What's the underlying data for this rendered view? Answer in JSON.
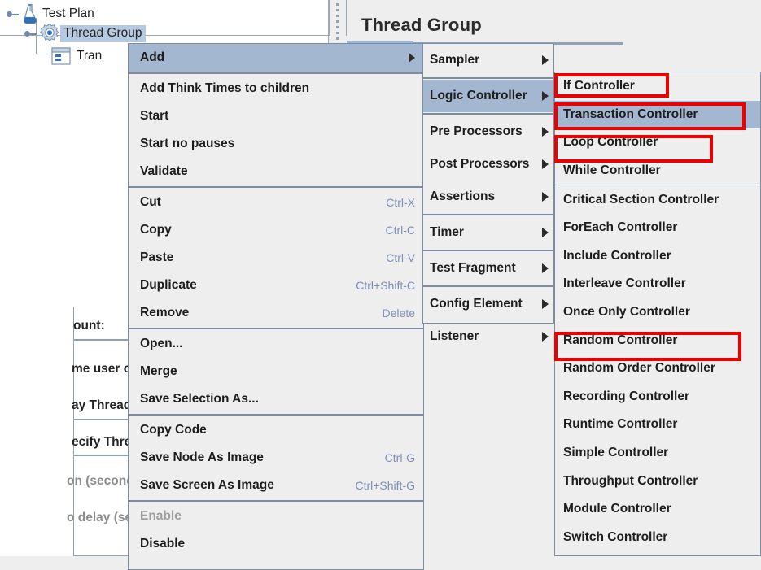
{
  "app": {
    "tree": {
      "nodes": [
        {
          "label": "Test Plan",
          "icon": "flask-icon",
          "selected": false
        },
        {
          "label": "Thread Group",
          "icon": "gear-icon",
          "selected": true
        },
        {
          "label": "Tran",
          "icon": "transaction-controller-icon",
          "selected": false
        }
      ]
    },
    "right_panel": {
      "title": "Thread Group",
      "background_text": {
        "count_label": "ount:",
        "hash_marks": "|||||||",
        "line1": "me user on each ite",
        "line2": "ay Thread creation",
        "line3": "ecify Thread lifetim",
        "line4": "on (seconds):",
        "line5": "o delay (seconds):"
      }
    }
  },
  "context_menu": {
    "items": [
      {
        "label": "Add",
        "accel": "",
        "submenu": true,
        "highlighted": true,
        "separator_after": true
      },
      {
        "label": "Add Think Times to children",
        "accel": "",
        "submenu": false
      },
      {
        "label": "Start",
        "accel": "",
        "submenu": false
      },
      {
        "label": "Start no pauses",
        "accel": "",
        "submenu": false
      },
      {
        "label": "Validate",
        "accel": "",
        "submenu": false,
        "separator_after": true
      },
      {
        "label": "Cut",
        "accel": "Ctrl-X",
        "submenu": false
      },
      {
        "label": "Copy",
        "accel": "Ctrl-C",
        "submenu": false
      },
      {
        "label": "Paste",
        "accel": "Ctrl-V",
        "submenu": false
      },
      {
        "label": "Duplicate",
        "accel": "Ctrl+Shift-C",
        "submenu": false
      },
      {
        "label": "Remove",
        "accel": "Delete",
        "submenu": false,
        "separator_after": true
      },
      {
        "label": "Open...",
        "accel": "",
        "submenu": false
      },
      {
        "label": "Merge",
        "accel": "",
        "submenu": false
      },
      {
        "label": "Save Selection As...",
        "accel": "",
        "submenu": false,
        "separator_after": true
      },
      {
        "label": "Copy Code",
        "accel": "",
        "submenu": false
      },
      {
        "label": "Save Node As Image",
        "accel": "Ctrl-G",
        "submenu": false
      },
      {
        "label": "Save Screen As Image",
        "accel": "Ctrl+Shift-G",
        "submenu": false,
        "separator_after": true
      },
      {
        "label": "Enable",
        "accel": "",
        "submenu": false,
        "disabled": true
      },
      {
        "label": "Disable",
        "accel": "",
        "submenu": false
      }
    ]
  },
  "add_submenu": {
    "items": [
      {
        "label": "Sampler",
        "submenu": true,
        "highlighted": false
      },
      {
        "label": "Logic Controller",
        "submenu": true,
        "highlighted": true
      },
      {
        "label": "Pre Processors",
        "submenu": true,
        "highlighted": false
      },
      {
        "label": "Post Processors",
        "submenu": true,
        "highlighted": false
      },
      {
        "label": "Assertions",
        "submenu": true,
        "highlighted": false
      },
      {
        "label": "Timer",
        "submenu": true,
        "highlighted": false
      },
      {
        "label": "Test Fragment",
        "submenu": true,
        "highlighted": false
      },
      {
        "label": "Config Element",
        "submenu": true,
        "highlighted": false
      },
      {
        "label": "Listener",
        "submenu": true,
        "highlighted": false
      }
    ]
  },
  "logic_controller_submenu": {
    "items": [
      {
        "label": "If Controller",
        "highlighted": false,
        "annotated": true
      },
      {
        "label": "Transaction Controller",
        "highlighted": true,
        "annotated": true
      },
      {
        "label": "Loop Controller",
        "highlighted": false,
        "annotated": true
      },
      {
        "label": "While Controller",
        "highlighted": false,
        "annotated": false
      },
      {
        "label": "Critical Section Controller",
        "highlighted": false,
        "annotated": false
      },
      {
        "label": "ForEach Controller",
        "highlighted": false,
        "annotated": false
      },
      {
        "label": "Include Controller",
        "highlighted": false,
        "annotated": false
      },
      {
        "label": "Interleave Controller",
        "highlighted": false,
        "annotated": false
      },
      {
        "label": "Once Only Controller",
        "highlighted": false,
        "annotated": false
      },
      {
        "label": "Random Controller",
        "highlighted": false,
        "annotated": true
      },
      {
        "label": "Random Order Controller",
        "highlighted": false,
        "annotated": false
      },
      {
        "label": "Recording Controller",
        "highlighted": false,
        "annotated": false
      },
      {
        "label": "Runtime Controller",
        "highlighted": false,
        "annotated": false
      },
      {
        "label": "Simple Controller",
        "highlighted": false,
        "annotated": false
      },
      {
        "label": "Throughput Controller",
        "highlighted": false,
        "annotated": false
      },
      {
        "label": "Module Controller",
        "highlighted": false,
        "annotated": false
      },
      {
        "label": "Switch Controller",
        "highlighted": false,
        "annotated": false
      }
    ]
  },
  "colors": {
    "menu_bg": "#eeeeee",
    "highlight": "#a3b8d0",
    "tree_selection": "#b5c9e0",
    "accelerator": "#7b90b8",
    "annotation_red": "#ee0000",
    "border": "#7d8ca0"
  }
}
